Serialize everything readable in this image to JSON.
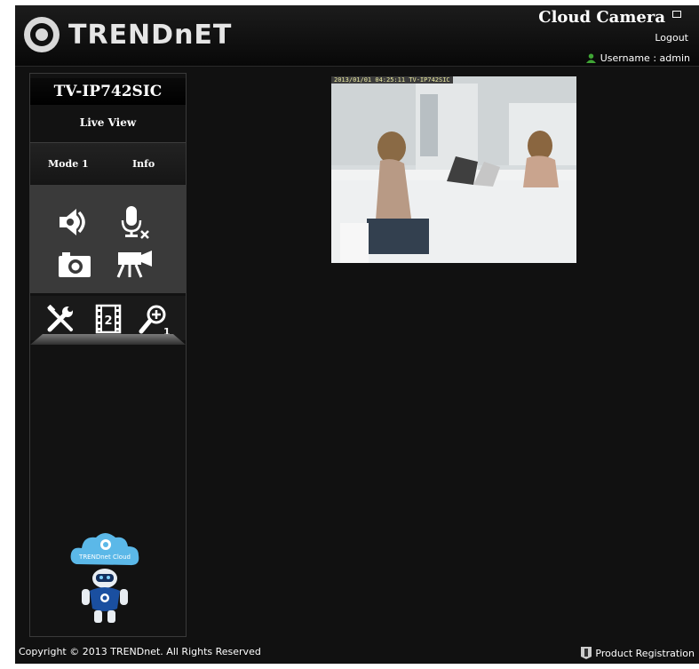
{
  "header": {
    "logo_text": "TRENDnET",
    "title": "Cloud Camera",
    "logout_label": "Logout",
    "user_text": "Username : admin"
  },
  "sidebar": {
    "model": "TV-IP742SIC",
    "live_view_label": "Live View",
    "tabs": [
      {
        "label": "Mode 1"
      },
      {
        "label": "Info"
      }
    ],
    "controls": [
      {
        "icon": "speaker-icon"
      },
      {
        "icon": "microphone-muted-icon"
      },
      {
        "icon": "snapshot-camera-icon"
      },
      {
        "icon": "video-record-icon"
      }
    ],
    "tools": [
      {
        "icon": "settings-tools-icon"
      },
      {
        "icon": "film-strip-icon",
        "text": "2"
      },
      {
        "icon": "zoom-in-icon",
        "text": "1"
      }
    ],
    "mascot_text": "TRENDnet Cloud"
  },
  "video": {
    "osd_text": "2013/01/01 04:25:11 TV-IP742SIC"
  },
  "footer": {
    "copyright": "Copyright © 2013 TRENDnet. All Rights Reserved",
    "product_registration": "Product Registration"
  },
  "colors": {
    "background": "#111111",
    "panel": "#3a3a3a",
    "user_icon": "#3fa535",
    "mascot_cloud": "#5bb8e8"
  }
}
